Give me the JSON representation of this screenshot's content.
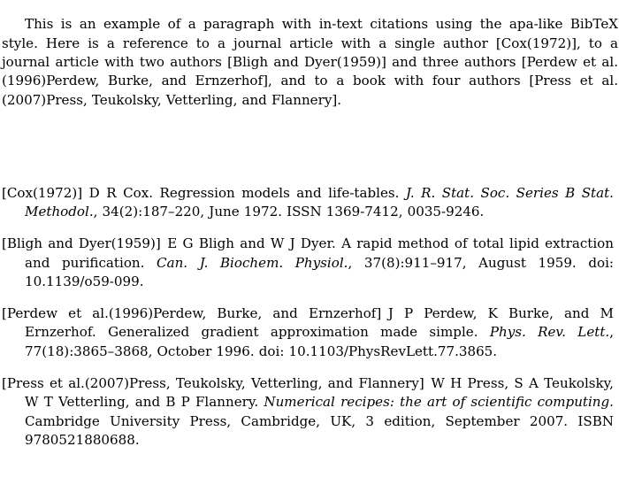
{
  "document": {
    "type": "bibliography-example",
    "background_color": "#ffffff",
    "text_color": "#000000",
    "paragraph": {
      "text": "This is an example of a paragraph with in-text citations using the apa-like BibTeX style. Here is a reference to a journal article with a single author [Cox(1972)], to a journal article with two authors [Bligh and Dyer(1959)] and three authors [Perdew et al.(1996)Perdew, Burke, and Ernzerhof], and to a book with four authors [Press et al.(2007)Press, Teukolsky, Vetterling, and Flannery]."
    },
    "bibliography": {
      "entries": [
        {
          "key": "[Cox(1972)]",
          "authors": "D R Cox.",
          "title": "Regression models and life-tables.",
          "journal": "J. R. Stat. Soc. Series B Stat. Methodol.",
          "details": ", 34(2):187–220, June 1972. ISSN 1369-7412, 0035-9246."
        },
        {
          "key": "[Bligh and Dyer(1959)]",
          "authors": "E G Bligh and W J Dyer.",
          "title": "A rapid method of total lipid extraction and purification.",
          "journal": "Can. J. Biochem. Physiol.",
          "details": ", 37(8):911–917, August 1959. doi: 10.1139/o59-099."
        },
        {
          "key": "[Perdew et al.(1996)Perdew, Burke, and Ernzerhof]",
          "authors": "J P Perdew, K Burke, and M Ernzerhof.",
          "title": "Generalized gradient approximation made simple.",
          "journal": "Phys. Rev. Lett.",
          "details": ", 77(18):3865–3868, October 1996. doi: 10.1103/PhysRevLett.77.3865."
        },
        {
          "key": "[Press et al.(2007)Press, Teukolsky, Vetterling, and Flannery]",
          "authors": "W H Press, S A Teukolsky, W T Vetterling, and B P Flannery.",
          "title": "",
          "journal": "Numerical recipes: the art of scientific computing.",
          "details": " Cambridge University Press, Cambridge, UK, 3 edition, September 2007. ISBN 9780521880688."
        }
      ]
    }
  }
}
